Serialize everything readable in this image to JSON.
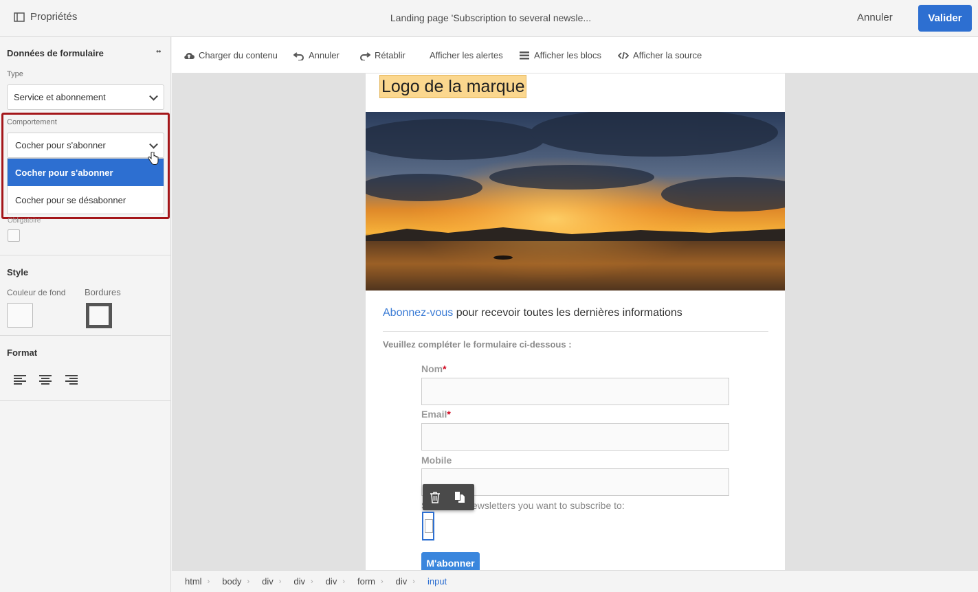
{
  "header": {
    "properties_label": "Propriétés",
    "title": "Landing page 'Subscription to several newsle...",
    "cancel_label": "Annuler",
    "validate_label": "Valider"
  },
  "left_panel": {
    "section_title": "Données de formulaire",
    "more_icon": "••",
    "type_label": "Type",
    "type_value": "Service et abonnement",
    "behavior_label": "Comportement",
    "behavior_value": "Cocher pour s'abonner",
    "behavior_options": [
      "Cocher pour s'abonner",
      "Cocher pour se désabonner"
    ],
    "mandatory_label": "Obligatoire",
    "style_title": "Style",
    "bg_color_label": "Couleur de fond",
    "borders_label": "Bordures",
    "format_title": "Format"
  },
  "toolbar": {
    "load_content": "Charger du contenu",
    "undo": "Annuler",
    "redo": "Rétablir",
    "show_alerts": "Afficher les alertes",
    "show_blocks": "Afficher les blocs",
    "show_source": "Afficher la source"
  },
  "page": {
    "logo": "Logo de la marque",
    "headline_link": "Abonnez-vous",
    "headline_rest": " pour recevoir toutes les dernières informations",
    "form_intro": "Veuillez compléter le formulaire ci-dessous :",
    "field_name": "Nom",
    "field_email": "Email",
    "field_mobile": "Mobile",
    "required_marker": "*",
    "newsletters_text": "Select the newsletters you want to subscribe to:",
    "subscribe_button": "M'abonner"
  },
  "breadcrumb": [
    "html",
    "body",
    "div",
    "div",
    "div",
    "form",
    "div",
    "input"
  ],
  "colors": {
    "accent": "#2d6fd1",
    "highlight_border": "#a4161a",
    "logo_bg": "#fbd78e"
  }
}
